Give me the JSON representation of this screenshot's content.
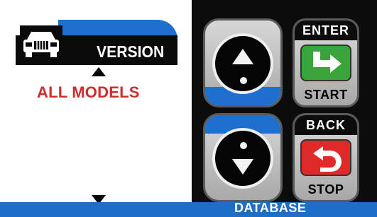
{
  "screen": {
    "version_label": "VERSION",
    "models_label": "ALL MODELS"
  },
  "footer": {
    "label": "DATABASE"
  },
  "keypad": {
    "enter_top": "ENTER",
    "enter_bottom": "START",
    "back_top": "BACK",
    "back_bottom": "STOP"
  },
  "icons": {
    "vehicle": "car-front-icon",
    "up": "up-arrow-icon",
    "down": "down-arrow-icon",
    "enter": "enter-arrow-icon",
    "back": "back-u-turn-icon"
  },
  "colors": {
    "accent_blue": "#1f6fcf",
    "models_red": "#cf2d2d",
    "enter_green": "#3aa43a",
    "back_red": "#e02a2a"
  }
}
